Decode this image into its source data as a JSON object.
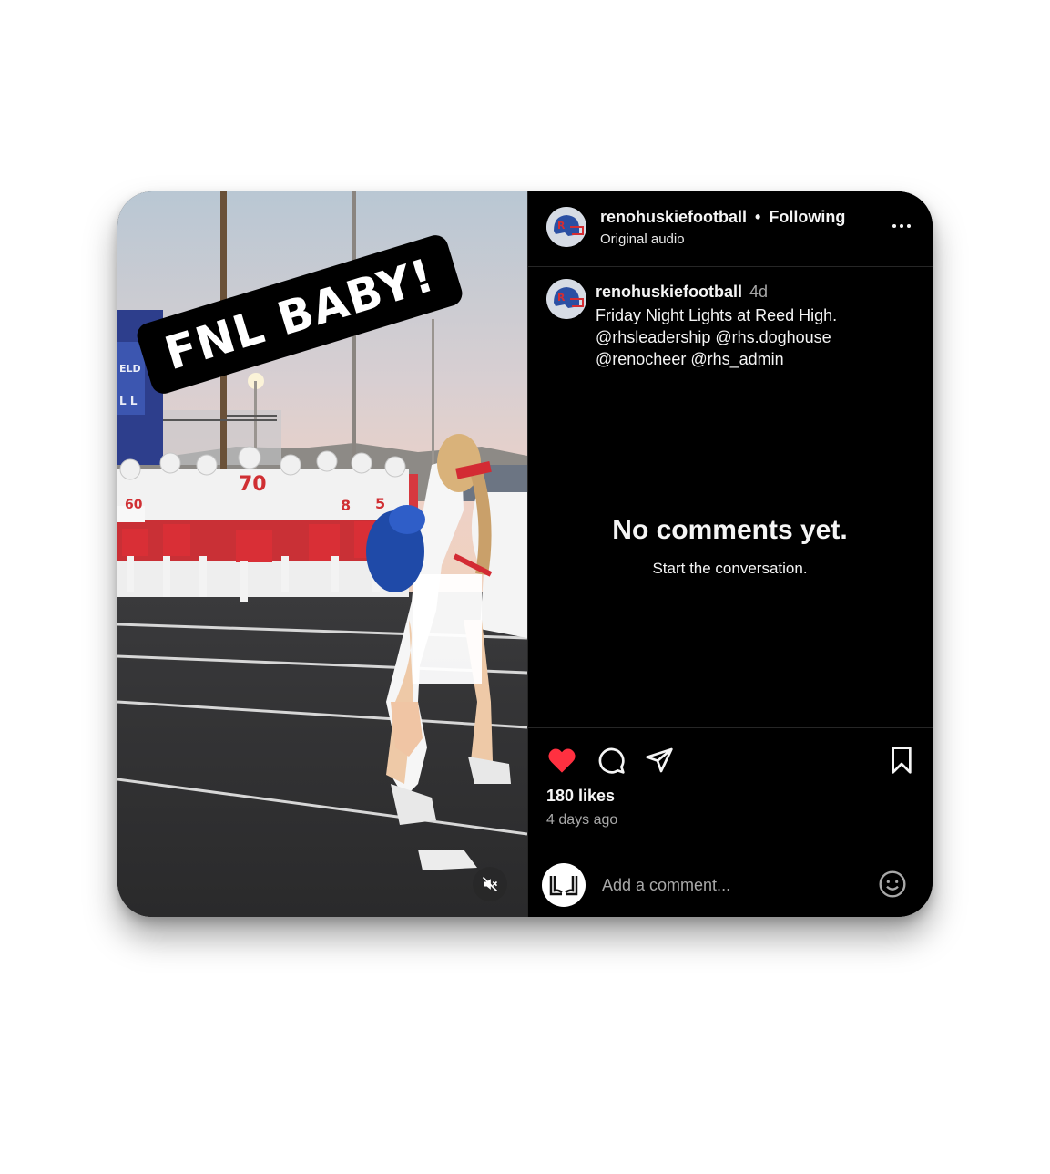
{
  "media": {
    "sticker_text": "FNL BABY!",
    "mute_icon": "speaker-muted-icon",
    "jersey_numbers": [
      "60",
      "70",
      "8",
      "5"
    ]
  },
  "header": {
    "username": "renohuskiefootball",
    "separator": "•",
    "follow_status": "Following",
    "audio": "Original audio",
    "more_icon": "more-options-icon"
  },
  "caption": {
    "username": "renohuskiefootball",
    "age": "4d",
    "text": "Friday Night Lights at Reed High.\n@rhsleadership @rhs.doghouse\n@renocheer @rhs_admin"
  },
  "comments": {
    "empty_title": "No comments yet.",
    "empty_subtitle": "Start the conversation."
  },
  "actions": {
    "like_icon": "heart-filled-icon",
    "comment_icon": "comment-icon",
    "share_icon": "send-icon",
    "save_icon": "bookmark-icon",
    "like_color": "#ff3040"
  },
  "stats": {
    "likes": "180 likes",
    "time": "4 days ago"
  },
  "add_comment": {
    "placeholder": "Add a comment...",
    "emoji_icon": "emoji-icon"
  }
}
